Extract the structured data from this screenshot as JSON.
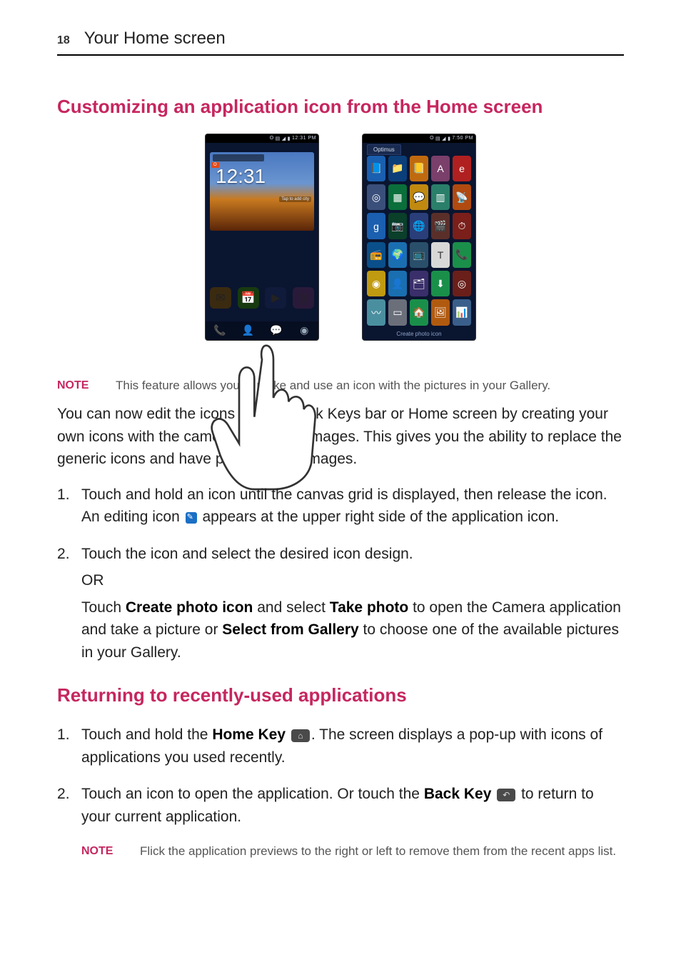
{
  "page": {
    "number": "18",
    "title": "Your Home screen"
  },
  "sections": {
    "customize_heading": "Customizing an application icon from the Home screen",
    "returning_heading": "Returning to recently-used applications"
  },
  "figures": {
    "phone1": {
      "status_time": "12:31 PM",
      "status_prefix": "O",
      "clock_time": "12:31",
      "edit_label": "O",
      "city_hint": "Tap to add city"
    },
    "phone2": {
      "status_time": "7:50 PM",
      "status_prefix": "O",
      "folder_label": "Optimus",
      "footer": "Create photo icon"
    }
  },
  "notes": {
    "label": "NOTE",
    "feature_note": "This feature allows you to make and use an icon with the pictures in your Gallery.",
    "flick_note": "Flick the application previews to the right or left to remove them from the recent apps list."
  },
  "body": {
    "intro": "You can now edit the icons on the Quick Keys bar or Home screen by creating your own icons with the camera or Gallery images. This gives you the ability to replace the generic icons and have personalized images."
  },
  "steps_a": {
    "s1_a": "Touch and hold an icon until the canvas grid is displayed, then release the icon. An editing icon ",
    "s1_b": " appears at the upper right side of the application icon.",
    "s2": "Touch the icon and select the desired icon design.",
    "or": "OR",
    "s2b_a": "Touch ",
    "s2b_create": "Create photo icon",
    "s2b_b": " and select ",
    "s2b_take": "Take photo",
    "s2b_c": " to open the Camera application and take a picture or ",
    "s2b_select": "Select from Gallery",
    "s2b_d": " to choose one of the available pictures in your Gallery."
  },
  "steps_b": {
    "s1_a": "Touch and hold the ",
    "s1_home": "Home Key",
    "s1_b": ". The screen displays a pop-up with icons of applications you used recently.",
    "s2_a": "Touch an icon to open the application. Or touch the ",
    "s2_back": "Back Key",
    "s2_b": " to return to your current application."
  },
  "icons": {
    "edit": "edit-icon",
    "home": "⌂",
    "back": "↶"
  }
}
